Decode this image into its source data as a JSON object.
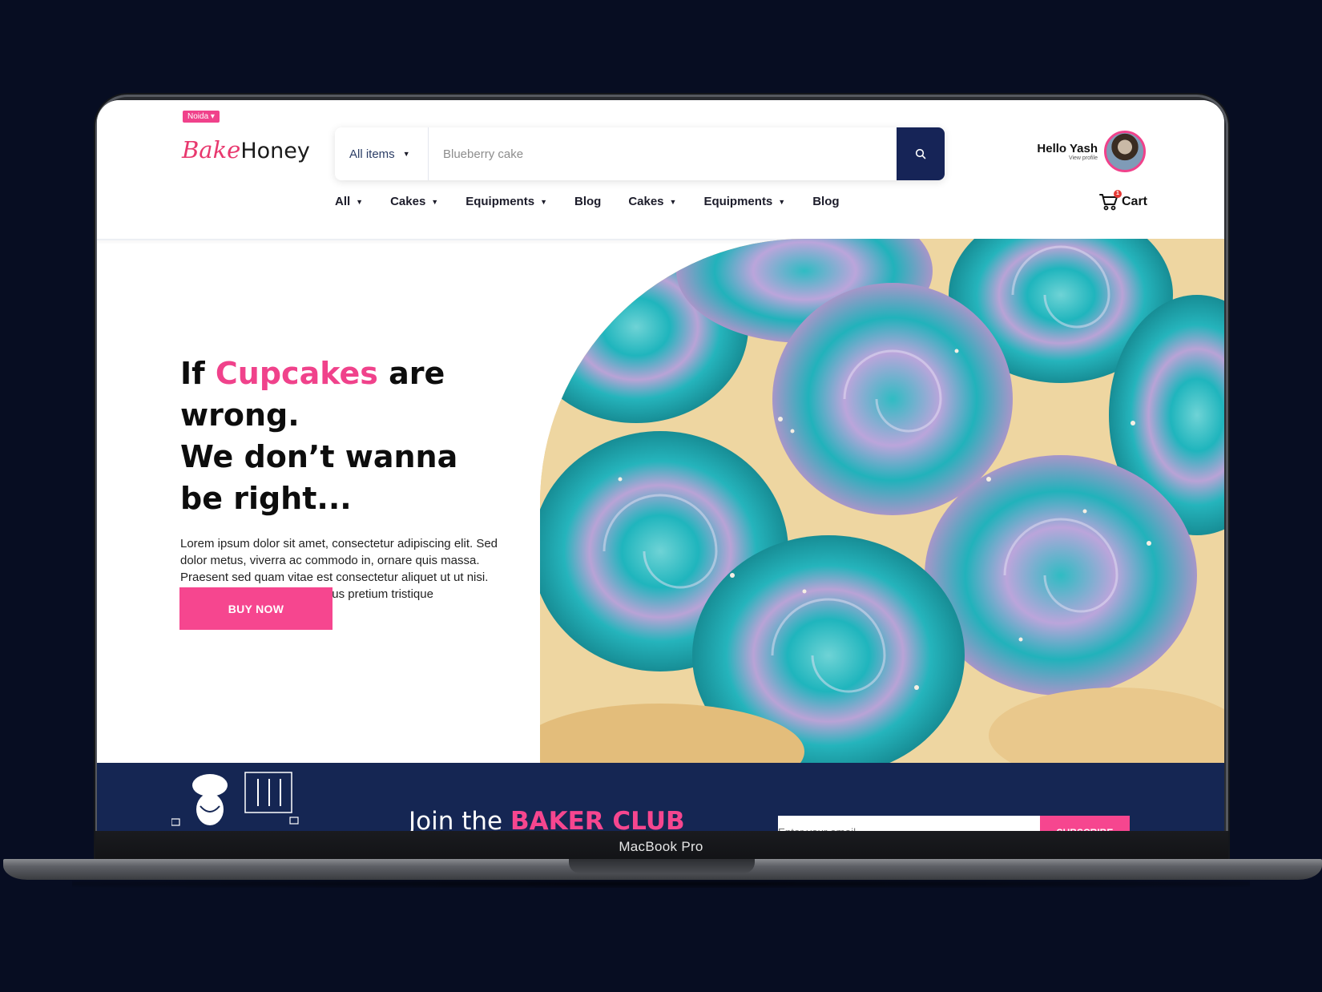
{
  "device": {
    "label": "MacBook Pro"
  },
  "header": {
    "location": "Noida",
    "logo_text_1": "Bake",
    "logo_text_2": "Honey",
    "search": {
      "category": "All items",
      "placeholder": "Blueberry cake"
    },
    "user": {
      "greeting": "Hello Yash",
      "sub": "View profile"
    },
    "cart": {
      "label": "Cart",
      "count": "1"
    }
  },
  "nav": {
    "items": [
      {
        "label": "All",
        "dropdown": true
      },
      {
        "label": "Cakes",
        "dropdown": true
      },
      {
        "label": "Equipments",
        "dropdown": true
      },
      {
        "label": "Blog",
        "dropdown": false
      },
      {
        "label": "Cakes",
        "dropdown": true
      },
      {
        "label": "Equipments",
        "dropdown": true
      },
      {
        "label": "Blog",
        "dropdown": false
      }
    ]
  },
  "hero": {
    "title_1": "If ",
    "title_accent": "Cupcakes",
    "title_2": " are wrong.",
    "title_3": "We don’t wanna",
    "title_4": "be right...",
    "description": "Lorem ipsum dolor sit amet, consectetur adipiscing elit. Sed dolor metus, viverra ac commodo in, ornare quis massa. Praesent sed quam vitae est consectetur aliquet ut ut nisi. Mauris fermentum ex nec risus pretium tristique",
    "cta": "BUY NOW"
  },
  "club": {
    "title_1": "Join the ",
    "title_accent": "BAKER CLUB",
    "input_placeholder": "Enter your email",
    "button": "SUBSCRIBE"
  },
  "colors": {
    "accent": "#f6468f",
    "navy": "#152653",
    "background": "#070d22"
  }
}
